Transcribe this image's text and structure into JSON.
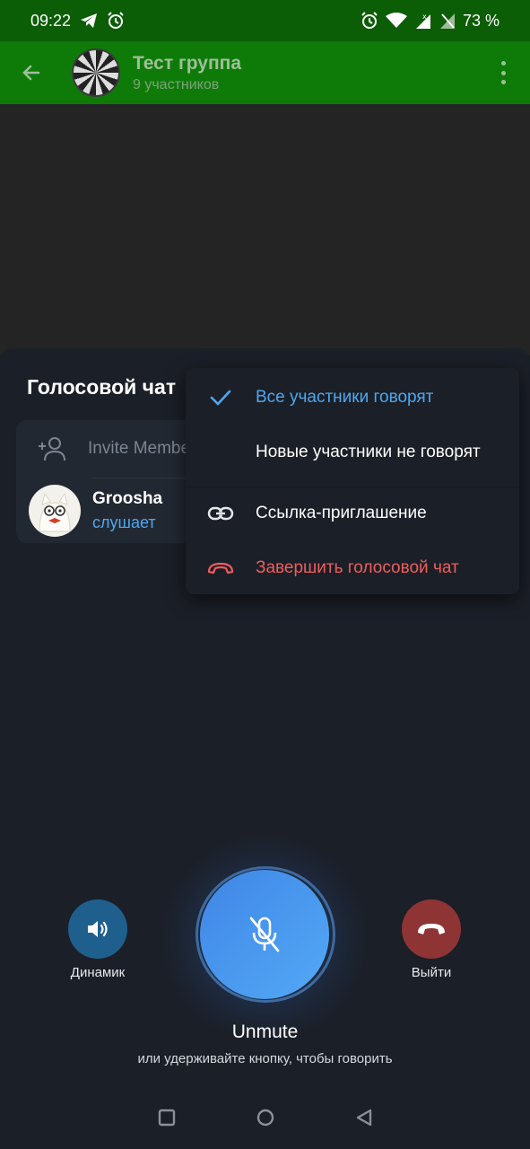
{
  "statusbar": {
    "time": "09:22",
    "battery": "73 %",
    "left_icons": [
      "telegram-icon",
      "alarm-icon"
    ],
    "right_icons": [
      "alarm-icon",
      "wifi-icon",
      "signal-icon",
      "battery-icon"
    ]
  },
  "appbar": {
    "title": "Тест группа",
    "subtitle": "9 участников"
  },
  "sheet": {
    "title": "Голосовой чат",
    "invite_label": "Invite Members",
    "members": [
      {
        "name": "Groosha",
        "status": "слушает"
      }
    ]
  },
  "menu": {
    "items": [
      {
        "label": "Все участники говорят",
        "icon": "check-icon",
        "checked": true,
        "color": "#4ea7f0"
      },
      {
        "label": "Новые участники не говорят",
        "icon": "",
        "checked": false,
        "color": "#ffffff"
      },
      {
        "label": "Ссылка-приглашение",
        "icon": "link-icon",
        "checked": false,
        "color": "#ffffff"
      },
      {
        "label": "Завершить голосовой чат",
        "icon": "hangup-icon",
        "checked": false,
        "color": "#f05d5d"
      }
    ]
  },
  "controls": {
    "speaker_label": "Динамик",
    "leave_label": "Выйти",
    "mic_state": "muted",
    "unmute_label": "Unmute",
    "hint": "или удерживайте кнопку, чтобы говорить"
  },
  "colors": {
    "statusbar": "#0b5d06",
    "appbar": "#0e7b09",
    "sheet_bg": "#1b1f27",
    "accent_blue": "#4ea7f0",
    "danger_red": "#f05d5d",
    "speaker_btn": "#1f5f8d",
    "leave_btn": "#8e3434"
  }
}
